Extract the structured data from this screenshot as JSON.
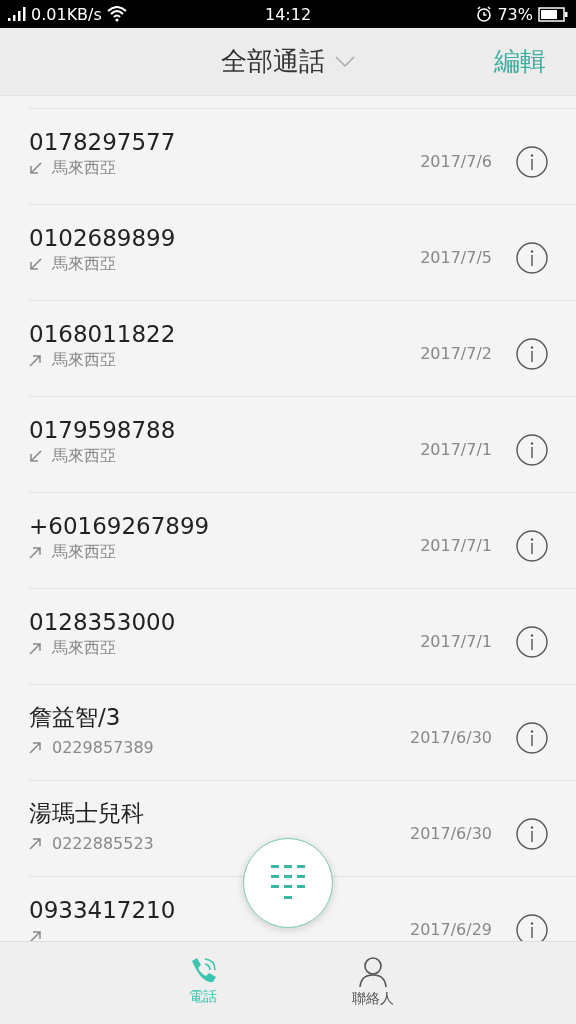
{
  "status_bar": {
    "speed": "0.01KB/s",
    "time": "14:12",
    "battery": "73%"
  },
  "header": {
    "title": "全部通話",
    "action": "編輯"
  },
  "calls": [
    {
      "name": "0178297577",
      "kind": "incoming",
      "detail": "馬來西亞",
      "date": "2017/7/6"
    },
    {
      "name": "0102689899",
      "kind": "incoming",
      "detail": "馬來西亞",
      "date": "2017/7/5"
    },
    {
      "name": "0168011822",
      "kind": "outgoing",
      "detail": "馬來西亞",
      "date": "2017/7/2"
    },
    {
      "name": "0179598788",
      "kind": "incoming",
      "detail": "馬來西亞",
      "date": "2017/7/1"
    },
    {
      "name": "+60169267899",
      "kind": "outgoing",
      "detail": "馬來西亞",
      "date": "2017/7/1"
    },
    {
      "name": "0128353000",
      "kind": "outgoing",
      "detail": "馬來西亞",
      "date": "2017/7/1"
    },
    {
      "name": "詹益智/3",
      "kind": "outgoing",
      "detail": "0229857389",
      "date": "2017/6/30"
    },
    {
      "name": "湯瑪士兒科",
      "kind": "outgoing",
      "detail": "0222885523",
      "date": "2017/6/30"
    },
    {
      "name": "0933417210",
      "kind": "outgoing",
      "date": "2017/6/29"
    }
  ],
  "tabs": [
    {
      "label": "電話",
      "kind": "phone",
      "selected": true
    },
    {
      "label": "聯絡人",
      "kind": "contact",
      "selected": false
    }
  ]
}
